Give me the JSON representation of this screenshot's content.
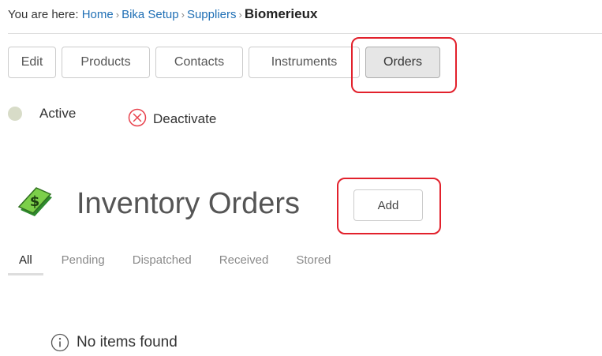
{
  "breadcrumb": {
    "prefix": "You are here:",
    "items": [
      "Home",
      "Bika Setup",
      "Suppliers"
    ],
    "separator": "›",
    "current": "Biomerieux"
  },
  "tabs": [
    {
      "label": "Edit",
      "active": false
    },
    {
      "label": "Products",
      "active": false
    },
    {
      "label": "Contacts",
      "active": false
    },
    {
      "label": "Instruments",
      "active": false
    },
    {
      "label": "Orders",
      "active": true
    }
  ],
  "state": {
    "status_label": "Active",
    "deactivate_label": "Deactivate"
  },
  "main": {
    "title": "Inventory Orders",
    "add_label": "Add",
    "icon": "money-icon"
  },
  "filters": [
    {
      "label": "All",
      "active": true
    },
    {
      "label": "Pending",
      "active": false
    },
    {
      "label": "Dispatched",
      "active": false
    },
    {
      "label": "Received",
      "active": false
    },
    {
      "label": "Stored",
      "active": false
    }
  ],
  "empty": {
    "icon": "info-icon",
    "message": "No items found"
  },
  "colors": {
    "link": "#1f6fb5",
    "highlight": "#e2212c",
    "deactivate_icon": "#e8414c",
    "active_dot": "#d8dcc8"
  }
}
